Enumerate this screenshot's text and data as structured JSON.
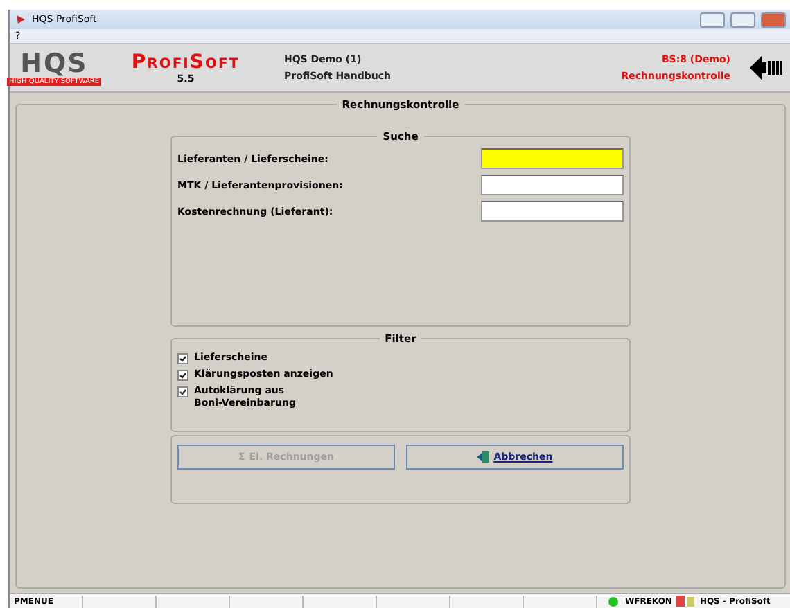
{
  "window": {
    "title": "HQS ProfiSoft"
  },
  "menu": [
    "?"
  ],
  "header": {
    "logo": "HQS",
    "logo_tagline": "HIGH QUALITY SOFTWARE",
    "product": "ProfiSoft",
    "version": "5.5",
    "client": "HQS Demo (1)",
    "manual": "ProfiSoft Handbuch",
    "bs": "BS:8 (Demo)",
    "module": "Rechnungskontrolle"
  },
  "main": {
    "title": "Rechnungskontrolle",
    "search": {
      "title": "Suche",
      "fields": [
        {
          "label": "Lieferanten / Lieferscheine:",
          "focused": true
        },
        {
          "label": "MTK / Lieferantenprovisionen:",
          "focused": false
        },
        {
          "label": "Kostenrechnung (Lieferant):",
          "focused": false
        }
      ]
    },
    "filter": {
      "title": "Filter",
      "options": [
        {
          "label": "Lieferscheine",
          "checked": true
        },
        {
          "label": "Klärungsposten anzeigen",
          "checked": true
        },
        {
          "label": "Autoklärung aus\nBoni-Vereinbarung",
          "checked": true
        }
      ]
    },
    "buttons": [
      {
        "label": "El. Rechnungen",
        "icon": "Σ",
        "disabled": true
      },
      {
        "label": "Abbrechen",
        "disabled": false
      }
    ]
  },
  "status_bar": {
    "cells": [
      "PMENUE",
      "",
      "",
      "",
      "",
      "",
      "",
      ""
    ],
    "online": true,
    "module": "WFREKON",
    "app": "HQS - ProfiSoft"
  }
}
